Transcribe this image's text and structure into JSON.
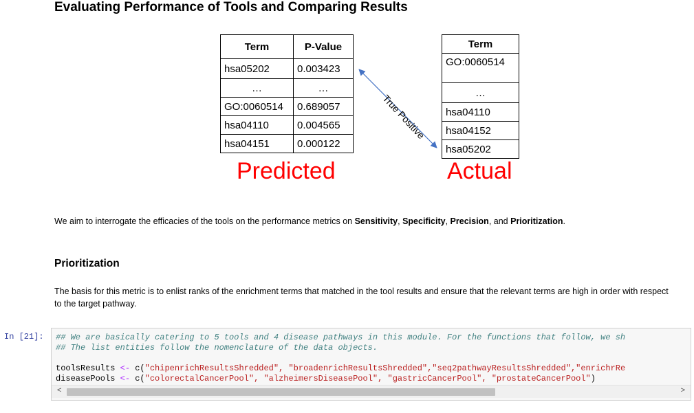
{
  "heading": "Evaluating Performance of Tools and Comparing Results",
  "predicted_table": {
    "headers": [
      "Term",
      "P-Value"
    ],
    "rows": [
      [
        "hsa05202",
        "0.003423"
      ],
      [
        "…",
        "…"
      ],
      [
        "GO:0060514",
        "0.689057"
      ],
      [
        "hsa04110",
        "0.004565"
      ],
      [
        "hsa04151",
        "0.000122"
      ]
    ]
  },
  "actual_table": {
    "header": "Term",
    "rows": [
      "GO:0060514",
      "…",
      "hsa04110",
      "hsa04152",
      "hsa05202"
    ]
  },
  "arrow_label": "True Positive",
  "predicted_label": "Predicted",
  "actual_label": "Actual",
  "intro": {
    "prefix": "We aim to interrogate the efficacies of the tools on the performance metrics on ",
    "m1": "Sensitivity",
    "sep1": ", ",
    "m2": "Specificity",
    "sep2": ", ",
    "m3": "Precision",
    "sep3": ", and ",
    "m4": "Prioritization",
    "suffix": "."
  },
  "section_title": "Prioritization",
  "section_text": "The basis for this metric is to enlist ranks of the enrichment terms that matched in the tool results and ensure that the relevant terms are high in order with respect to the target pathway.",
  "cell": {
    "prompt": "In [21]:",
    "comment1": "## We are basically catering to 5 tools and 4 disease pathways in this module. For the functions that follow, we sh",
    "comment2": "## The list entities follow the nomenclature of the data objects.",
    "line3_var": "toolsResults",
    "line3_op": " <- ",
    "line3_fn": "c(",
    "line3_args": "\"chipenrichResultsShredded\", \"broadenrichResultsShredded\",\"seq2pathwayResultsShredded\",\"enrichrRe",
    "line4_var": "diseasePools",
    "line4_op": " <- ",
    "line4_fn": "c(",
    "line4_args": "\"colorectalCancerPool\", \"alzheimersDiseasePool\", \"gastricCancerPool\", \"prostateCancerPool\"",
    "line4_close": ")"
  },
  "scroll_left_icon": "<",
  "scroll_right_icon": ">"
}
